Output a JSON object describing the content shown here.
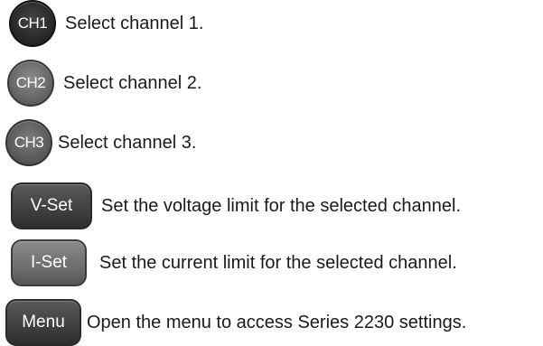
{
  "keys": [
    {
      "label": "CH1",
      "description": "Select channel 1."
    },
    {
      "label": "CH2",
      "description": "Select channel 2."
    },
    {
      "label": "CH3",
      "description": "Select channel 3."
    },
    {
      "label": "V-Set",
      "description": "Set the voltage limit for the selected channel."
    },
    {
      "label": "I-Set",
      "description": "Set the current limit for the selected channel."
    },
    {
      "label": "Menu",
      "description": "Open the menu to access Series 2230 settings."
    }
  ]
}
